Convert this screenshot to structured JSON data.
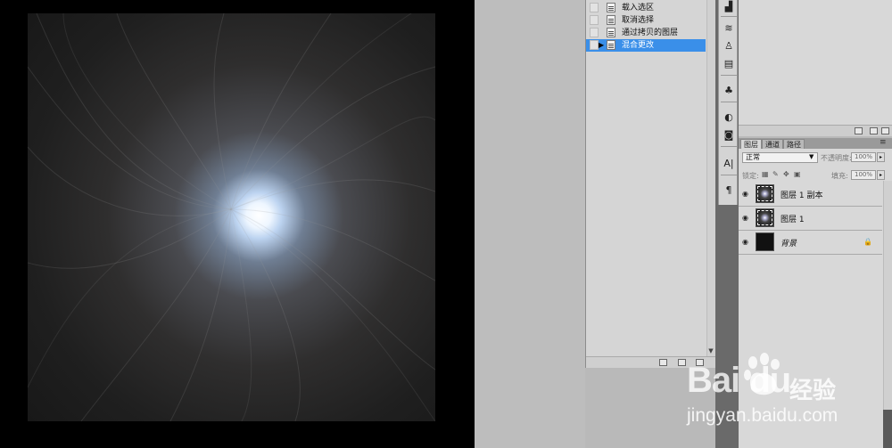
{
  "history": {
    "items": [
      {
        "label": "载入选区",
        "selected": false
      },
      {
        "label": "取消选择",
        "selected": false
      },
      {
        "label": "通过拷贝的图层",
        "selected": false
      },
      {
        "label": "混合更改",
        "selected": true
      }
    ]
  },
  "layers_panel": {
    "tabs": [
      "图层",
      "通道",
      "路径"
    ],
    "blend_mode": "正常",
    "opacity_label": "不透明度:",
    "opacity_value": "100%",
    "lock_label": "锁定:",
    "fill_label": "填充:",
    "fill_value": "100%",
    "layers": [
      {
        "name": "图层 1 副本",
        "thumb": "glow",
        "locked": false
      },
      {
        "name": "图层 1",
        "thumb": "glow",
        "locked": false
      },
      {
        "name": "背景",
        "thumb": "black",
        "locked": true
      }
    ]
  },
  "watermark": {
    "logo_text": "Bai du",
    "logo_sub": "经验",
    "url": "jingyan.baidu.com"
  }
}
